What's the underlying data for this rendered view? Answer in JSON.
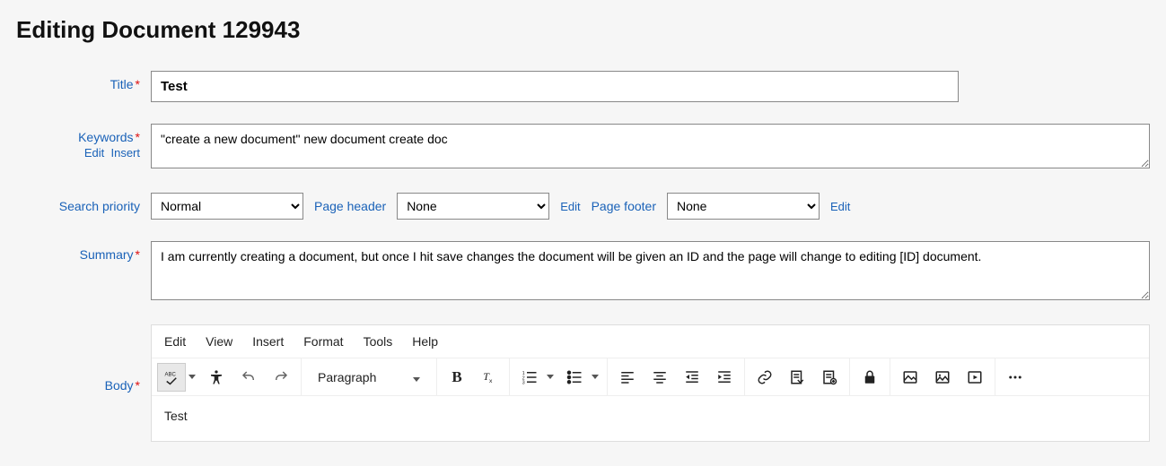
{
  "page_title": "Editing Document 129943",
  "labels": {
    "title": "Title",
    "keywords": "Keywords",
    "search_priority": "Search priority",
    "page_header": "Page header",
    "page_footer": "Page footer",
    "summary": "Summary",
    "body": "Body"
  },
  "actions": {
    "edit": "Edit",
    "insert": "Insert"
  },
  "values": {
    "title": "Test",
    "keywords": "\"create a new document\" new document create doc",
    "search_priority": "Normal",
    "page_header": "None",
    "page_footer": "None",
    "summary": "I am currently creating a document, but once I hit save changes the document will be given an ID and the page will change to editing [ID] document.",
    "body": "Test"
  },
  "editor": {
    "menubar": [
      "Edit",
      "View",
      "Insert",
      "Format",
      "Tools",
      "Help"
    ],
    "block_format": "Paragraph"
  }
}
